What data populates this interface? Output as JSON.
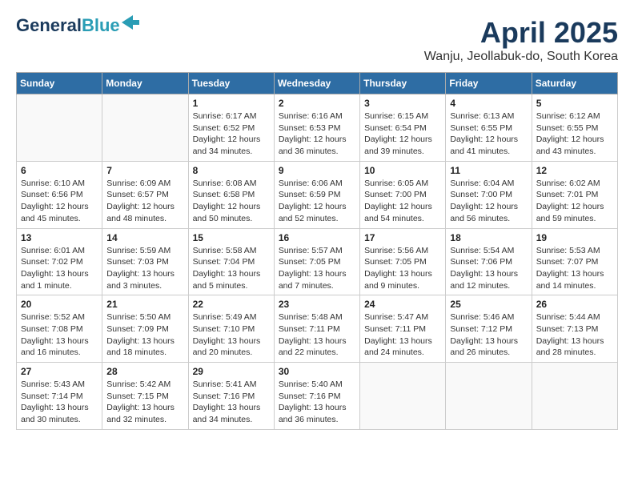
{
  "logo": {
    "line1": "General",
    "line2": "Blue",
    "arrow": "▶"
  },
  "title": "April 2025",
  "location": "Wanju, Jeollabuk-do, South Korea",
  "headers": [
    "Sunday",
    "Monday",
    "Tuesday",
    "Wednesday",
    "Thursday",
    "Friday",
    "Saturday"
  ],
  "weeks": [
    [
      {
        "day": "",
        "info": ""
      },
      {
        "day": "",
        "info": ""
      },
      {
        "day": "1",
        "info": "Sunrise: 6:17 AM\nSunset: 6:52 PM\nDaylight: 12 hours\nand 34 minutes."
      },
      {
        "day": "2",
        "info": "Sunrise: 6:16 AM\nSunset: 6:53 PM\nDaylight: 12 hours\nand 36 minutes."
      },
      {
        "day": "3",
        "info": "Sunrise: 6:15 AM\nSunset: 6:54 PM\nDaylight: 12 hours\nand 39 minutes."
      },
      {
        "day": "4",
        "info": "Sunrise: 6:13 AM\nSunset: 6:55 PM\nDaylight: 12 hours\nand 41 minutes."
      },
      {
        "day": "5",
        "info": "Sunrise: 6:12 AM\nSunset: 6:55 PM\nDaylight: 12 hours\nand 43 minutes."
      }
    ],
    [
      {
        "day": "6",
        "info": "Sunrise: 6:10 AM\nSunset: 6:56 PM\nDaylight: 12 hours\nand 45 minutes."
      },
      {
        "day": "7",
        "info": "Sunrise: 6:09 AM\nSunset: 6:57 PM\nDaylight: 12 hours\nand 48 minutes."
      },
      {
        "day": "8",
        "info": "Sunrise: 6:08 AM\nSunset: 6:58 PM\nDaylight: 12 hours\nand 50 minutes."
      },
      {
        "day": "9",
        "info": "Sunrise: 6:06 AM\nSunset: 6:59 PM\nDaylight: 12 hours\nand 52 minutes."
      },
      {
        "day": "10",
        "info": "Sunrise: 6:05 AM\nSunset: 7:00 PM\nDaylight: 12 hours\nand 54 minutes."
      },
      {
        "day": "11",
        "info": "Sunrise: 6:04 AM\nSunset: 7:00 PM\nDaylight: 12 hours\nand 56 minutes."
      },
      {
        "day": "12",
        "info": "Sunrise: 6:02 AM\nSunset: 7:01 PM\nDaylight: 12 hours\nand 59 minutes."
      }
    ],
    [
      {
        "day": "13",
        "info": "Sunrise: 6:01 AM\nSunset: 7:02 PM\nDaylight: 13 hours\nand 1 minute."
      },
      {
        "day": "14",
        "info": "Sunrise: 5:59 AM\nSunset: 7:03 PM\nDaylight: 13 hours\nand 3 minutes."
      },
      {
        "day": "15",
        "info": "Sunrise: 5:58 AM\nSunset: 7:04 PM\nDaylight: 13 hours\nand 5 minutes."
      },
      {
        "day": "16",
        "info": "Sunrise: 5:57 AM\nSunset: 7:05 PM\nDaylight: 13 hours\nand 7 minutes."
      },
      {
        "day": "17",
        "info": "Sunrise: 5:56 AM\nSunset: 7:05 PM\nDaylight: 13 hours\nand 9 minutes."
      },
      {
        "day": "18",
        "info": "Sunrise: 5:54 AM\nSunset: 7:06 PM\nDaylight: 13 hours\nand 12 minutes."
      },
      {
        "day": "19",
        "info": "Sunrise: 5:53 AM\nSunset: 7:07 PM\nDaylight: 13 hours\nand 14 minutes."
      }
    ],
    [
      {
        "day": "20",
        "info": "Sunrise: 5:52 AM\nSunset: 7:08 PM\nDaylight: 13 hours\nand 16 minutes."
      },
      {
        "day": "21",
        "info": "Sunrise: 5:50 AM\nSunset: 7:09 PM\nDaylight: 13 hours\nand 18 minutes."
      },
      {
        "day": "22",
        "info": "Sunrise: 5:49 AM\nSunset: 7:10 PM\nDaylight: 13 hours\nand 20 minutes."
      },
      {
        "day": "23",
        "info": "Sunrise: 5:48 AM\nSunset: 7:11 PM\nDaylight: 13 hours\nand 22 minutes."
      },
      {
        "day": "24",
        "info": "Sunrise: 5:47 AM\nSunset: 7:11 PM\nDaylight: 13 hours\nand 24 minutes."
      },
      {
        "day": "25",
        "info": "Sunrise: 5:46 AM\nSunset: 7:12 PM\nDaylight: 13 hours\nand 26 minutes."
      },
      {
        "day": "26",
        "info": "Sunrise: 5:44 AM\nSunset: 7:13 PM\nDaylight: 13 hours\nand 28 minutes."
      }
    ],
    [
      {
        "day": "27",
        "info": "Sunrise: 5:43 AM\nSunset: 7:14 PM\nDaylight: 13 hours\nand 30 minutes."
      },
      {
        "day": "28",
        "info": "Sunrise: 5:42 AM\nSunset: 7:15 PM\nDaylight: 13 hours\nand 32 minutes."
      },
      {
        "day": "29",
        "info": "Sunrise: 5:41 AM\nSunset: 7:16 PM\nDaylight: 13 hours\nand 34 minutes."
      },
      {
        "day": "30",
        "info": "Sunrise: 5:40 AM\nSunset: 7:16 PM\nDaylight: 13 hours\nand 36 minutes."
      },
      {
        "day": "",
        "info": ""
      },
      {
        "day": "",
        "info": ""
      },
      {
        "day": "",
        "info": ""
      }
    ]
  ]
}
